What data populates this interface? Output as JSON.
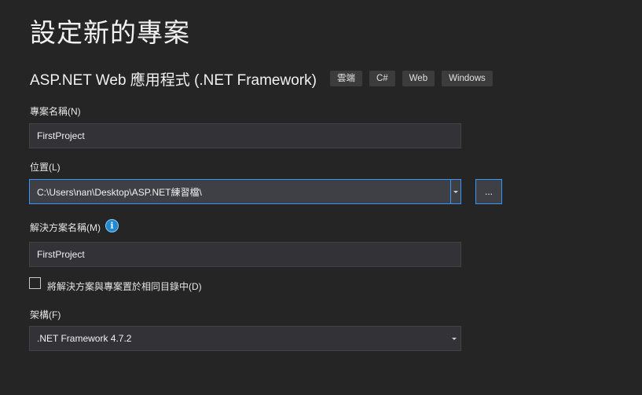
{
  "page": {
    "title": "設定新的專案"
  },
  "template": {
    "name": "ASP.NET Web 應用程式 (.NET Framework)",
    "tags": [
      "雲端",
      "C#",
      "Web",
      "Windows"
    ]
  },
  "project_name": {
    "label": "專案名稱(N)",
    "value": "FirstProject"
  },
  "location": {
    "label": "位置(L)",
    "value": "C:\\Users\\nan\\Desktop\\ASP.NET練習檔\\",
    "browse_label": "..."
  },
  "solution_name": {
    "label": "解決方案名稱(M)",
    "info_glyph": "i",
    "value": "FirstProject"
  },
  "same_directory": {
    "label": "將解決方案與專案置於相同目錄中(D)",
    "checked": false
  },
  "framework": {
    "label": "架構(F)",
    "value": ".NET Framework 4.7.2"
  },
  "colors": {
    "background": "#252526",
    "accent": "#3399ff",
    "field": "#333337",
    "tag": "#3c3c3c"
  }
}
